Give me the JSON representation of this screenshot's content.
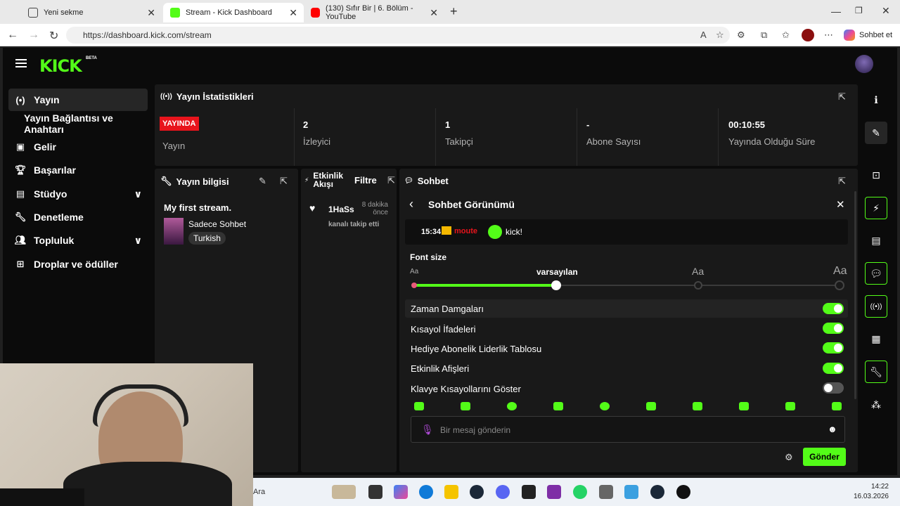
{
  "browser": {
    "tabs": [
      {
        "label": "Yeni sekme",
        "icon": "new-tab-icon"
      },
      {
        "label": "Stream - Kick Dashboard",
        "icon": "kick-icon"
      },
      {
        "label": "(130) Sıfır Bir | 6. Bölüm - YouTube",
        "icon": "youtube-icon"
      }
    ],
    "url": "https://dashboard.kick.com/stream",
    "copilot_label": "Sohbet et"
  },
  "app": {
    "logo": "KICK",
    "beta": "BETA"
  },
  "sidebar": {
    "items": [
      {
        "label": "Yayın",
        "icon": "broadcast-icon"
      },
      {
        "label": "Yayın Bağlantısı ve Anahtarı",
        "icon": ""
      },
      {
        "label": "Gelir",
        "icon": "revenue-icon"
      },
      {
        "label": "Başarılar",
        "icon": "trophy-icon"
      },
      {
        "label": "Stüdyo",
        "icon": "studio-icon"
      },
      {
        "label": "Denetleme",
        "icon": "wrench-icon"
      },
      {
        "label": "Topluluk",
        "icon": "community-icon"
      },
      {
        "label": "Droplar ve ödüller",
        "icon": "gift-icon"
      }
    ]
  },
  "stats": {
    "title": "Yayın İstatistikleri",
    "live_badge": "YAYINDA",
    "items": [
      {
        "value": "",
        "label": "Yayın"
      },
      {
        "value": "2",
        "label": "İzleyici"
      },
      {
        "value": "1",
        "label": "Takipçi"
      },
      {
        "value": "-",
        "label": "Abone Sayısı"
      },
      {
        "value": "00:10:55",
        "label": "Yayında Olduğu Süre"
      }
    ]
  },
  "stream_info": {
    "title": "Yayın bilgisi",
    "stream_title": "My first stream.",
    "category": "Sadece Sohbet",
    "tag": "Turkish"
  },
  "activity": {
    "title": "Etkinlik Akışı",
    "filter": "Filtre",
    "event_user": "1HaSs",
    "event_time": "8 dakika önce",
    "event_text": "kanalı takip etti"
  },
  "chat": {
    "title": "Sohbet",
    "view_title": "Sohbet Görünümü",
    "preview": {
      "time": "15:34",
      "user": "moute",
      "text": "kick!"
    },
    "font_size_label": "Font size",
    "font_small": "Aa",
    "font_default": "varsayılan",
    "font_medium": "Aa",
    "font_large": "Aa",
    "settings": [
      {
        "label": "Zaman Damgaları",
        "on": true
      },
      {
        "label": "Kısayol İfadeleri",
        "on": true
      },
      {
        "label": "Hediye Abonelik Liderlik Tablosu",
        "on": true
      },
      {
        "label": "Etkinlik Afişleri",
        "on": true
      },
      {
        "label": "Klavye Kısayollarını Göster",
        "on": false
      }
    ],
    "input_placeholder": "Bir mesaj gönderin",
    "send_label": "Gönder"
  },
  "taskbar": {
    "search": "Ara",
    "time": "14:22",
    "date": "16.03.2026"
  },
  "colors": {
    "brand": "#53fc18",
    "live": "#e8141c",
    "panel": "#191919"
  }
}
